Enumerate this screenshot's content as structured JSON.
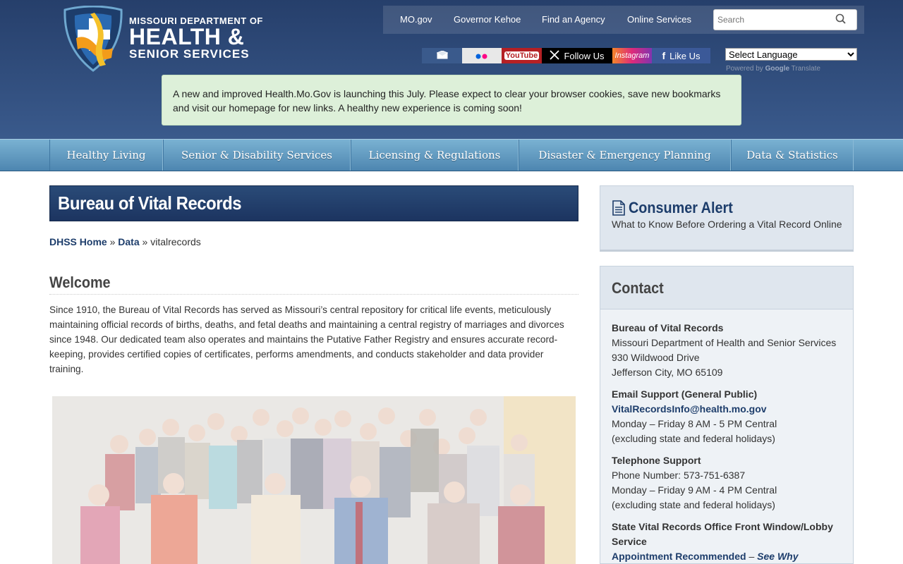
{
  "logo": {
    "line1": "MISSOURI DEPARTMENT OF",
    "line2": "HEALTH &",
    "line3": "SENIOR SERVICES"
  },
  "topnav": {
    "links": [
      "MO.gov",
      "Governor Kehoe",
      "Find an Agency",
      "Online Services"
    ],
    "search_placeholder": "Search"
  },
  "social": {
    "youtube": "YouTube",
    "x_follow": "Follow Us",
    "instagram": "Instagram",
    "facebook": "Like Us"
  },
  "translate": {
    "select_label": "Select Language",
    "powered_by": "Powered by",
    "google": "Google",
    "translate": "Translate"
  },
  "notice": "A new and improved Health.Mo.Gov is launching this July. Please expect to clear your browser cookies, save new bookmarks and visit our homepage for new links. A healthy new experience is coming soon!",
  "mainnav": [
    "Healthy Living",
    "Senior & Disability Services",
    "Licensing & Regulations",
    "Disaster & Emergency Planning",
    "Data & Statistics"
  ],
  "page": {
    "title": "Bureau of Vital Records",
    "breadcrumb": {
      "home": "DHSS Home",
      "sep": "»",
      "data": "Data",
      "current": "vitalrecords"
    },
    "welcome_heading": "Welcome",
    "intro": "Since 1910, the Bureau of Vital Records has served as Missouri’s central repository for critical life events, meticulously maintaining official records of births, deaths, and fetal deaths and maintaining a central registry of marriages and divorces since 1948. Our dedicated team also operates and maintains the Putative Father Registry and ensures accurate record-keeping, provides certified copies of certificates, performs amendments, and conducts stakeholder and data provider training."
  },
  "sidebar": {
    "alert_title": "Consumer Alert",
    "alert_sub": "What to Know Before Ordering a Vital Record Online",
    "contact_heading": "Contact",
    "org_name": "Bureau of Vital Records",
    "org_line1": "Missouri Department of Health and Senior Services",
    "org_line2": "930 Wildwood Drive",
    "org_line3": "Jefferson City, MO 65109",
    "email_heading": "Email Support (General Public)",
    "email": "VitalRecordsInfo@health.mo.gov",
    "email_hours": "Monday – Friday 8 AM - 5 PM Central",
    "email_note": "(excluding state and federal holidays)",
    "phone_heading": "Telephone Support",
    "phone": "Phone Number: 573-751-6387",
    "phone_hours": "Monday – Friday 9 AM - 4 PM Central",
    "phone_note": "(excluding state and federal holidays)",
    "office_heading": "State Vital Records Office Front Window/Lobby Service",
    "appt": "Appointment Recommended",
    "appt_dash": " – ",
    "see_why": "See Why"
  }
}
